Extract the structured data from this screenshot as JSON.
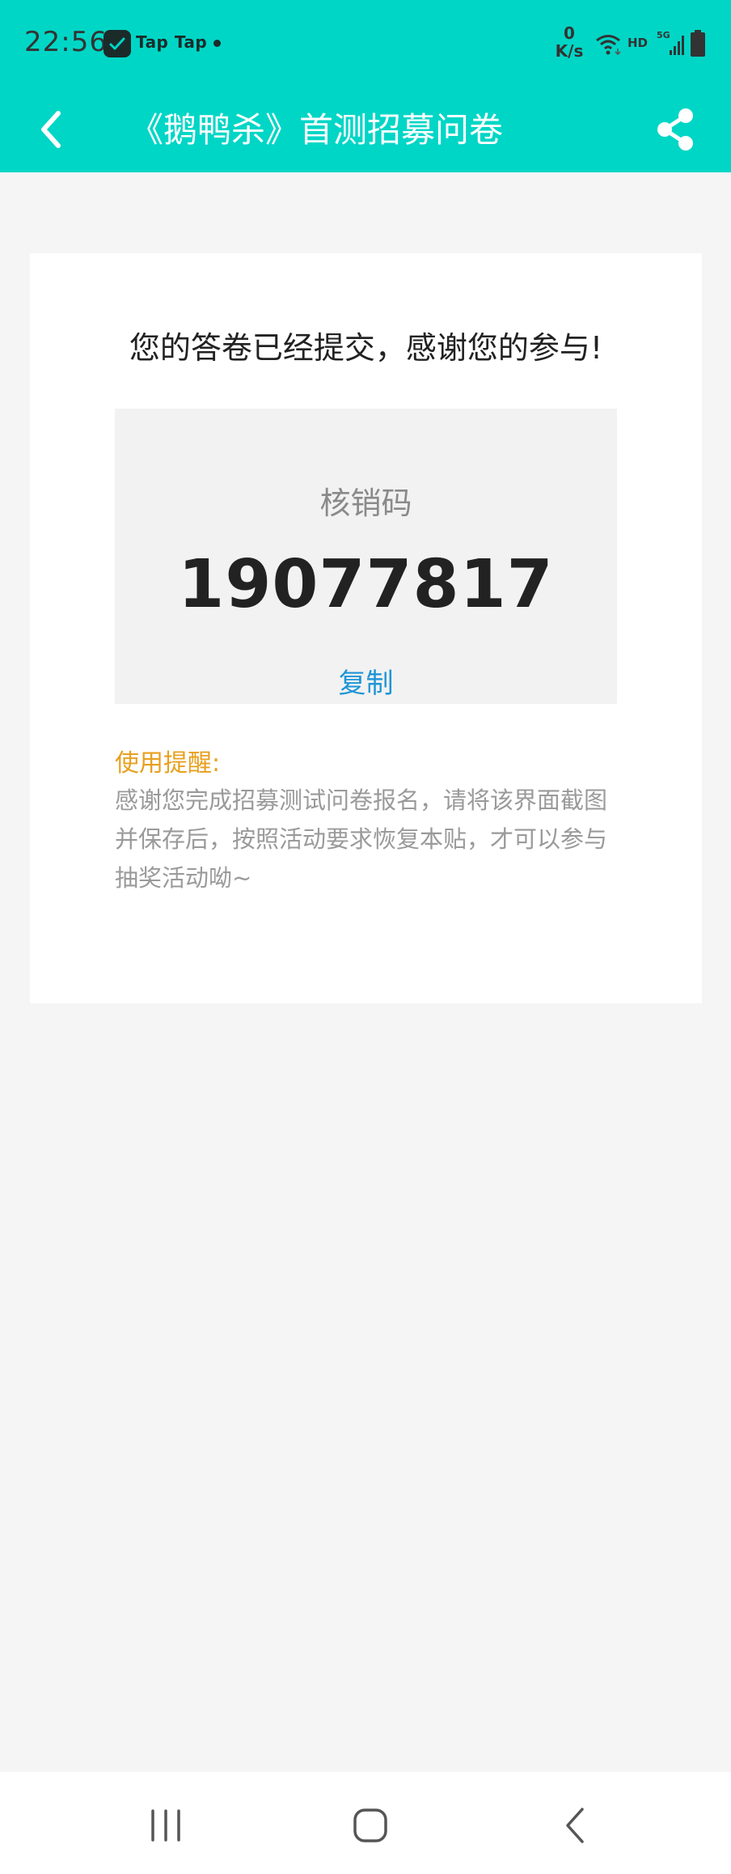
{
  "status_bar": {
    "time": "22:56",
    "app_name": "Tap Tap",
    "net_speed_value": "0",
    "net_speed_unit": "K/s",
    "hd_label": "HD",
    "network_type": "5G",
    "icons": [
      "taptap-logo-icon",
      "wifi-icon",
      "signal-icon",
      "battery-icon"
    ]
  },
  "nav": {
    "title": "《鹅鸭杀》首测招募问卷",
    "back_icon": "chevron-left-icon",
    "share_icon": "share-icon"
  },
  "result": {
    "message": "您的答卷已经提交，感谢您的参与!",
    "code_label": "核销码",
    "code": "19077817",
    "copy_label": "复制",
    "reminder_title": "使用提醒:",
    "reminder_text": "感谢您完成招募测试问卷报名，请将该界面截图并保存后，按照活动要求恢复本贴，才可以参与抽奖活动呦~"
  },
  "colors": {
    "header": "#00d6c6",
    "copy_link": "#1f95d6",
    "reminder_title": "#e7a01f",
    "background": "#f5f5f6"
  },
  "system_nav": {
    "icons": [
      "recents-icon",
      "home-icon",
      "back-icon"
    ]
  }
}
